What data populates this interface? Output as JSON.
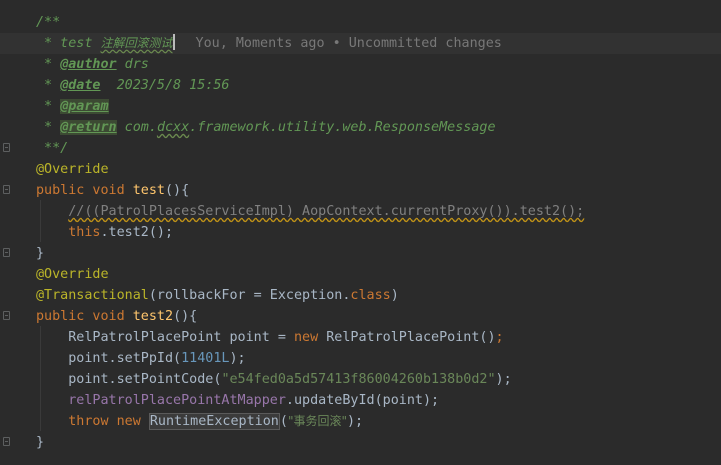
{
  "editor": {
    "inline_hint": "You, Moments ago • Uncommitted changes",
    "lines": {
      "l1": "/**",
      "l2_prefix": " * test ",
      "l2_cjk": "注解回滚测试",
      "l3_star": " * ",
      "l3_tag": "@author",
      "l3_value": " drs",
      "l4_star": " * ",
      "l4_tag": "@date",
      "l4_value": "  2023/5/8 15:56",
      "l5_star": " * ",
      "l5_tag": "@param",
      "l6_star": " * ",
      "l6_tag": "@return",
      "l6_v1": " com.",
      "l6_v2": "dcxx",
      "l6_v3": ".framework.utility.web.ResponseMessage",
      "l7": " **/",
      "l8_ann": "@Override",
      "l9_kw": "public void ",
      "l9_method": "test",
      "l9_rest": "(){",
      "l10_indent": "    ",
      "l10_comment": "//((PatrolPlacesServiceImpl) AopContext.currentProxy()).test2();",
      "l11_indent": "    ",
      "l11_kw": "this",
      "l11_rest": ".test2();",
      "l12": "}",
      "l13_ann": "@Override",
      "l14_ann": "@Transactional",
      "l14_rest1": "(rollbackFor = Exception.",
      "l14_kw": "class",
      "l14_rest2": ")",
      "l15_kw": "public void ",
      "l15_method": "test2",
      "l15_rest": "(){",
      "l16_indent": "    ",
      "l16_a": "RelPatrolPlacePoint point = ",
      "l16_kw": "new ",
      "l16_b": "RelPatrolPlacePoint()",
      "l16_semi": ";",
      "l17_indent": "    ",
      "l17_a": "point.setPpId(",
      "l17_num": "11401L",
      "l17_b": ");",
      "l18_indent": "    ",
      "l18_a": "point.setPointCode(",
      "l18_str": "\"e54fed0a5d57413f86004260b138b0d2\"",
      "l18_b": ");",
      "l19_indent": "    ",
      "l19_field": "relPatrolPlacePointAtMapper",
      "l19_rest": ".updateById(point);",
      "l20_indent": "    ",
      "l20_kw": "throw new ",
      "l20_cls": "RuntimeException",
      "l20_open": "(",
      "l20_str": "\"事务回滚\"",
      "l20_close": ");",
      "l21": "}"
    }
  }
}
